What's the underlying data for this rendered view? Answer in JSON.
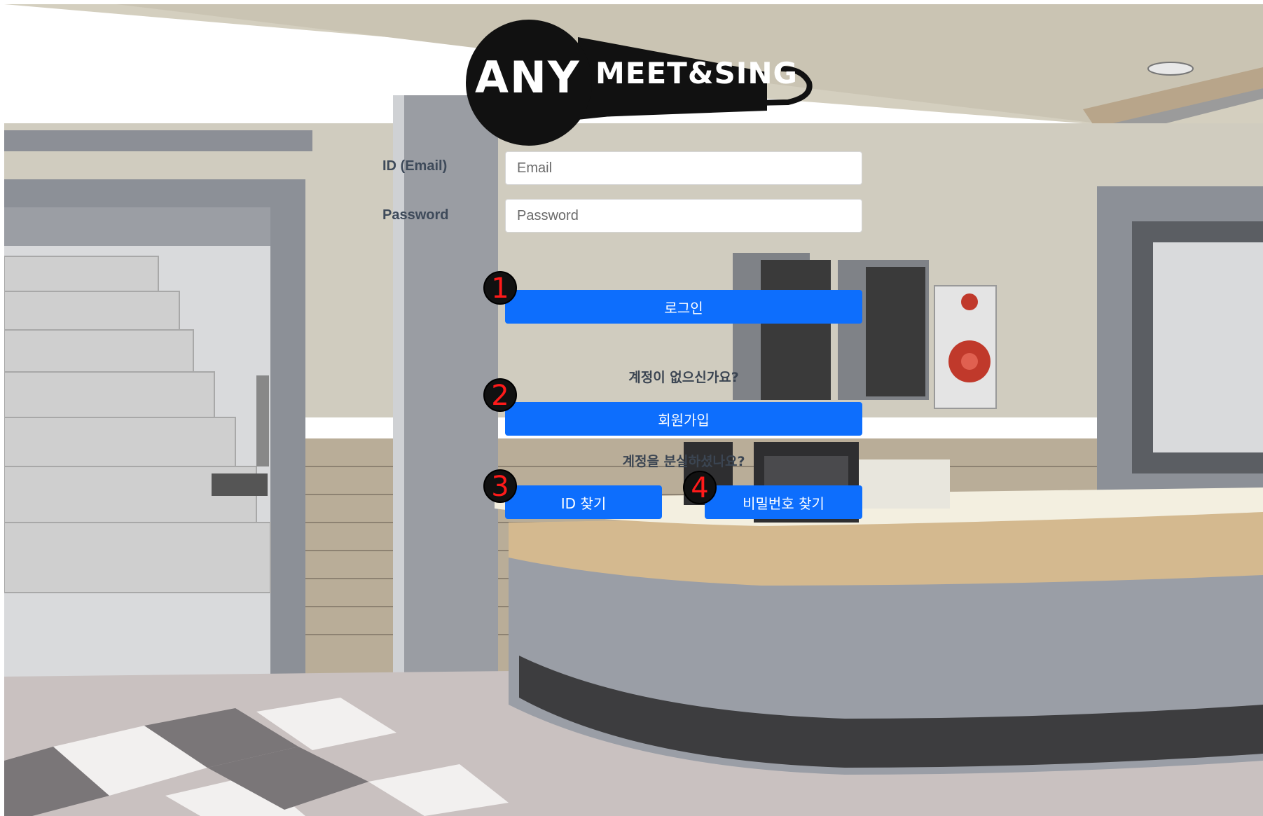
{
  "logo": {
    "left_text": "ANY",
    "right_text": "MEET&SING"
  },
  "form": {
    "email": {
      "label": "ID (Email)",
      "placeholder": "Email",
      "value": ""
    },
    "password": {
      "label": "Password",
      "placeholder": "Password",
      "value": ""
    }
  },
  "buttons": {
    "login": "로그인",
    "signup": "회원가입",
    "find_id": "ID 찾기",
    "find_password": "비밀번호 찾기"
  },
  "helpers": {
    "no_account": "계정이 없으신가요?",
    "lost_account": "계정을 분실하셨나요?"
  },
  "badges": [
    "1",
    "2",
    "3",
    "4"
  ],
  "colors": {
    "primary_button": "#0d6efd",
    "badge_background": "#111111",
    "badge_text": "#ff1a1a"
  },
  "icons": {
    "logo": "microphone-logo-icon"
  }
}
